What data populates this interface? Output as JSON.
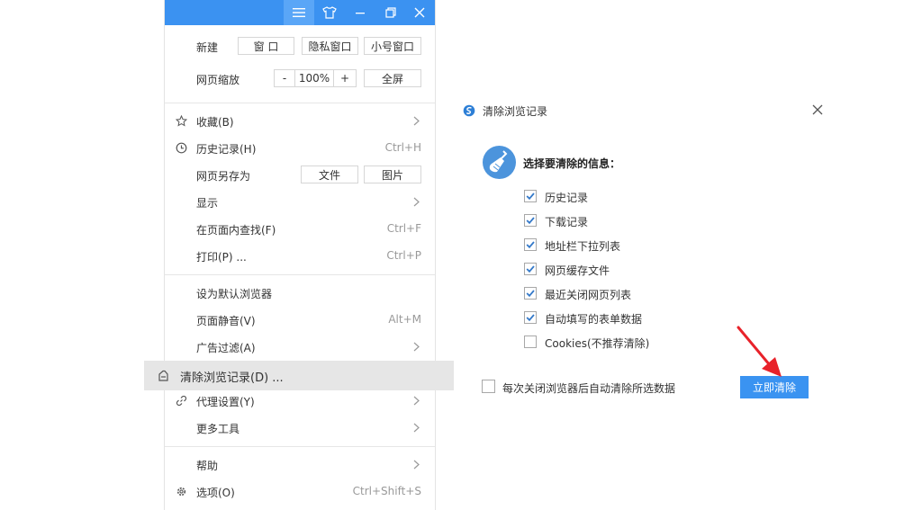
{
  "menu": {
    "new_label": "新建",
    "new_window": "窗 口",
    "private_window": "隐私窗口",
    "small_window": "小号窗口",
    "zoom_label": "网页缩放",
    "zoom_minus": "-",
    "zoom_value": "100%",
    "zoom_plus": "+",
    "fullscreen": "全屏",
    "favorites": "收藏(B)",
    "history": "历史记录(H)",
    "history_shortcut": "Ctrl+H",
    "save_as": "网页另存为",
    "save_file": "文件",
    "save_image": "图片",
    "display": "显示",
    "find": "在页面内查找(F)",
    "find_shortcut": "Ctrl+F",
    "print": "打印(P) ...",
    "print_shortcut": "Ctrl+P",
    "default_browser": "设为默认浏览器",
    "mute": "页面静音(V)",
    "mute_shortcut": "Alt+M",
    "ad_filter": "广告过滤(A)",
    "clear_history": "清除浏览记录(D) ...",
    "proxy": "代理设置(Y)",
    "more_tools": "更多工具",
    "help": "帮助",
    "options": "选项(O)",
    "options_shortcut": "Ctrl+Shift+S"
  },
  "dialog": {
    "title": "清除浏览记录",
    "heading": "选择要清除的信息：",
    "options": [
      {
        "label": "历史记录",
        "checked": true
      },
      {
        "label": "下载记录",
        "checked": true
      },
      {
        "label": "地址栏下拉列表",
        "checked": true
      },
      {
        "label": "网页缓存文件",
        "checked": true
      },
      {
        "label": "最近关闭网页列表",
        "checked": true
      },
      {
        "label": "自动填写的表单数据",
        "checked": true
      },
      {
        "label": "Cookies(不推荐清除)",
        "checked": false
      }
    ],
    "auto_clear_label": "每次关闭浏览器后自动清除所选数据",
    "clear_button": "立即清除"
  },
  "colors": {
    "accent": "#3a93f1",
    "arrow": "#e8222a",
    "check": "#3479c9"
  }
}
